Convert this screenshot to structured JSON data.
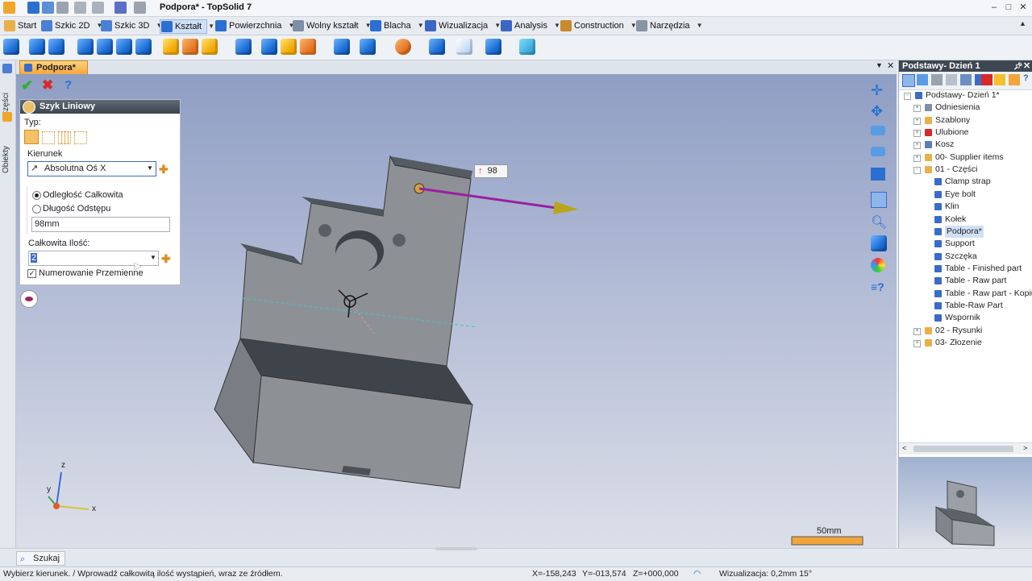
{
  "window": {
    "title": "Podpora* - TopSolid 7"
  },
  "menu": [
    {
      "label": "Start"
    },
    {
      "label": "Szkic 2D"
    },
    {
      "label": "Szkic 3D"
    },
    {
      "label": "Kształt"
    },
    {
      "label": "Powierzchnia"
    },
    {
      "label": "Wolny kształt"
    },
    {
      "label": "Blacha"
    },
    {
      "label": "Wizualizacja"
    },
    {
      "label": "Analysis"
    },
    {
      "label": "Construction"
    },
    {
      "label": "Narzędzia"
    }
  ],
  "doc_tab": {
    "label": "Podpora*"
  },
  "left_tabs": {
    "parts": "Części",
    "objects": "Obiekty"
  },
  "dialog": {
    "title": "Szyk Liniowy",
    "type_label": "Typ:",
    "direction_label": "Kierunek",
    "direction_value": "Absolutna Oś X",
    "option_total": "Odległość Całkowita",
    "option_step": "Długość Odstępu",
    "distance_value": "98mm",
    "count_label": "Całkowita Ilość:",
    "count_value": "2",
    "alternate_label": "Numerowanie Przemienne"
  },
  "viewport": {
    "dimension_value": "98",
    "scale_label": "50mm",
    "axis_z": "z",
    "axis_y": "y",
    "axis_x": "x"
  },
  "right_panel": {
    "title": "Podstawy- Dzień 1",
    "tree": [
      {
        "label": "Podstawy- Dzień 1*",
        "level": 0,
        "expand": "-",
        "icon": "project"
      },
      {
        "label": "Odniesienia",
        "level": 1,
        "expand": "+",
        "icon": "references"
      },
      {
        "label": "Szablony",
        "level": 1,
        "expand": "+",
        "icon": "folder"
      },
      {
        "label": "Ulubione",
        "level": 1,
        "expand": "+",
        "icon": "favorites"
      },
      {
        "label": "Kosz",
        "level": 1,
        "expand": "+",
        "icon": "trash"
      },
      {
        "label": "00- Supplier items",
        "level": 1,
        "expand": "+",
        "icon": "folder"
      },
      {
        "label": "01 - Części",
        "level": 1,
        "expand": "-",
        "icon": "folder"
      },
      {
        "label": "Clamp strap",
        "level": 2,
        "icon": "part"
      },
      {
        "label": "Eye bolt",
        "level": 2,
        "icon": "part"
      },
      {
        "label": "Klin",
        "level": 2,
        "icon": "part"
      },
      {
        "label": "Kołek",
        "level": 2,
        "icon": "part"
      },
      {
        "label": "Podpora*",
        "level": 2,
        "icon": "part",
        "selected": true
      },
      {
        "label": "Support",
        "level": 2,
        "icon": "part"
      },
      {
        "label": "Szczęka",
        "level": 2,
        "icon": "part"
      },
      {
        "label": "Table - Finished part",
        "level": 2,
        "icon": "part"
      },
      {
        "label": "Table - Raw part",
        "level": 2,
        "icon": "part"
      },
      {
        "label": "Table - Raw part - Kopiuj",
        "level": 2,
        "icon": "part"
      },
      {
        "label": "Table-Raw Part",
        "level": 2,
        "icon": "part"
      },
      {
        "label": "Wspornik",
        "level": 2,
        "icon": "part"
      },
      {
        "label": "02 - Rysunki",
        "level": 1,
        "expand": "+",
        "icon": "folder"
      },
      {
        "label": "03- Złozenie",
        "level": 1,
        "expand": "+",
        "icon": "folder"
      }
    ]
  },
  "find": {
    "label": "Szukaj"
  },
  "status": {
    "message": "Wybierz kierunek. / Wprowadź całkowitą ilość wystąpień, wraz ze źródłem.",
    "x": "X=-158,243",
    "y": "Y=-013,574",
    "z": "Z=+000,000",
    "visualization": "Wizualizacja: 0,2mm 15°"
  },
  "colors": {
    "accent": "#f2a53b",
    "selection": "#cfe0f6",
    "arrow": "#9b1fa0"
  }
}
